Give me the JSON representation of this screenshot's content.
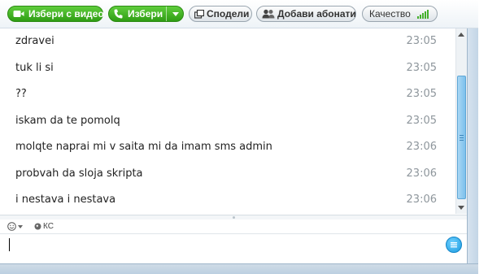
{
  "toolbar": {
    "video_call_label": "Избери с видео",
    "call_label": "Избери",
    "share_label": "Сподели",
    "add_contacts_label": "Добави абонати",
    "quality_label": "Качество",
    "quality_signal_level": 5
  },
  "messages": [
    {
      "text": "zdravei",
      "time": "23:05"
    },
    {
      "text": "tuk li si",
      "time": "23:05"
    },
    {
      "text": "??",
      "time": "23:05"
    },
    {
      "text": "iskam da te pomolq",
      "time": "23:05"
    },
    {
      "text": "molqte naprai mi v saita mi da imam sms admin",
      "time": "23:06"
    },
    {
      "text": "probvah da sloja skripta",
      "time": "23:06"
    },
    {
      "text": "i nestava i nestava",
      "time": "23:06"
    }
  ],
  "status": {
    "keyboard_layout": "КС"
  },
  "input": {
    "value": "",
    "placeholder": ""
  },
  "colors": {
    "accent_green": "#2f9d14",
    "timestamp_gray": "#8e969c",
    "scroll_blue": "#7dc0ec",
    "send_blue": "#1a9be0"
  },
  "icons": {
    "video": "video-camera-icon",
    "call": "phone-icon",
    "share": "share-screen-icon",
    "add": "add-contacts-icon",
    "quality": "signal-bars-icon",
    "emoticon": "smiley-icon",
    "send": "send-message-icon"
  }
}
